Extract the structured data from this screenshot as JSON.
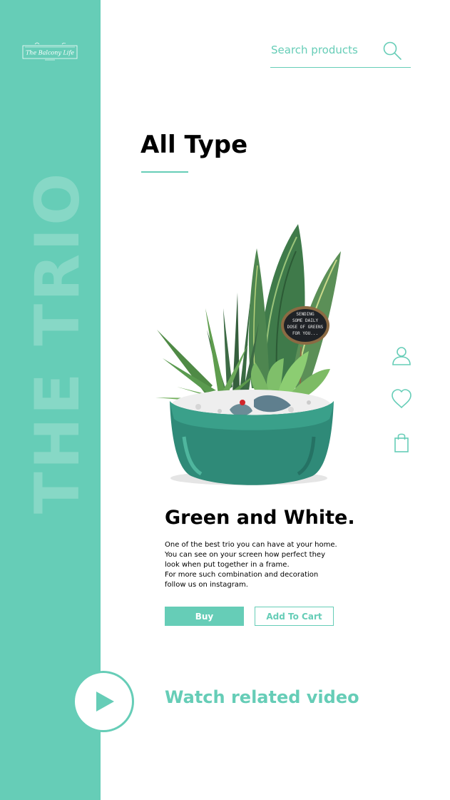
{
  "brand": {
    "logo_text": "The Balcony Life"
  },
  "search": {
    "placeholder": "Search products"
  },
  "page": {
    "title": "All Type"
  },
  "sidebar": {
    "vertical_text": "THE TRIO"
  },
  "product": {
    "sign_text": [
      "SENDING",
      "SOME DAILY",
      "DOSE OF GREENS",
      "FOR YOU..."
    ],
    "title": "Green and White.",
    "description_lines": [
      "One of the best trio you can have at your home.",
      "You can see on your screen how perfect they",
      "look when put together in a frame.",
      "For more such combination and decoration",
      "follow us on instagram."
    ],
    "buy_label": "Buy",
    "cart_label": "Add To Cart"
  },
  "side_icons": [
    "user-icon",
    "heart-icon",
    "bag-icon"
  ],
  "video": {
    "label": "Watch related video",
    "icon": "play-icon"
  },
  "colors": {
    "accent": "#66cdb7",
    "text": "#000000",
    "background": "#ffffff"
  }
}
